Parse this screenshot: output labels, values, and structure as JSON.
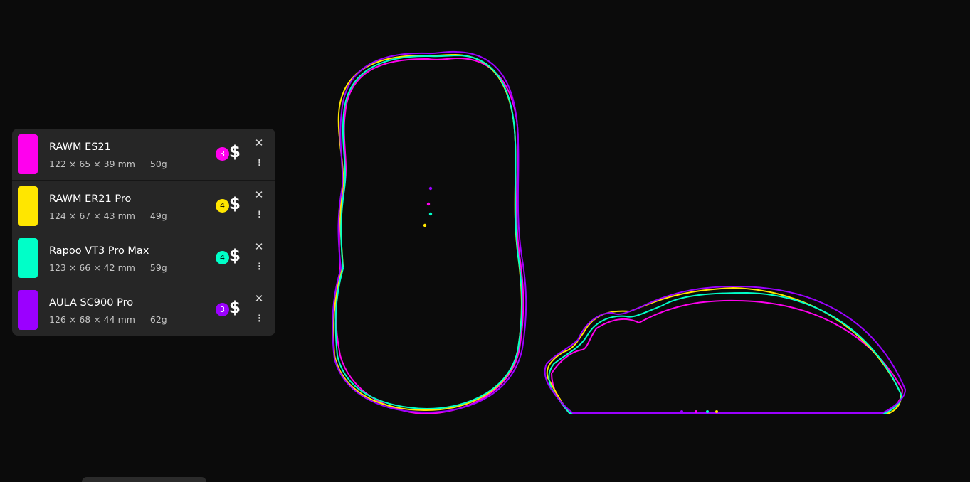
{
  "mice": [
    {
      "name": "RAWM ES21",
      "length": "122",
      "width": "65",
      "height": "39",
      "unit": "mm",
      "weight": "50g",
      "price_tier": "3",
      "currency_symbol": "$",
      "color": "#ff00ee",
      "badge_text_color": "dark"
    },
    {
      "name": "RAWM ER21 Pro",
      "length": "124",
      "width": "67",
      "height": "43",
      "unit": "mm",
      "weight": "49g",
      "price_tier": "4",
      "currency_symbol": "$",
      "color": "#ffe600",
      "badge_text_color": "light"
    },
    {
      "name": "Rapoo VT3 Pro Max",
      "length": "123",
      "width": "66",
      "height": "42",
      "unit": "mm",
      "weight": "59g",
      "price_tier": "4",
      "currency_symbol": "$",
      "color": "#00ffc8",
      "badge_text_color": "light"
    },
    {
      "name": "AULA SC900 Pro",
      "length": "126",
      "width": "68",
      "height": "44",
      "unit": "mm",
      "weight": "62g",
      "price_tier": "3",
      "currency_symbol": "$",
      "color": "#9b00ff",
      "badge_text_color": "dark"
    }
  ],
  "dimension_separator": "×",
  "icons": {
    "close": "close-icon",
    "more": "more-vertical-icon",
    "price": "dollar-icon"
  },
  "colors": {
    "background": "#0b0b0b",
    "panel": "#262626"
  }
}
